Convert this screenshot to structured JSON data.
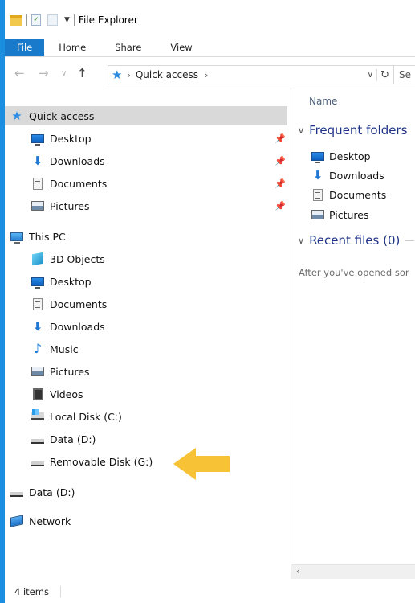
{
  "window": {
    "title": "File Explorer"
  },
  "ribbon": {
    "tabs": [
      "File",
      "Home",
      "Share",
      "View"
    ]
  },
  "address": {
    "path_root": "Quick access",
    "search_placeholder": "Se"
  },
  "nav": {
    "quick_access": "Quick access",
    "quick_items": [
      "Desktop",
      "Downloads",
      "Documents",
      "Pictures"
    ],
    "this_pc": "This PC",
    "pc_items": [
      "3D Objects",
      "Desktop",
      "Documents",
      "Downloads",
      "Music",
      "Pictures",
      "Videos",
      "Local Disk (C:)",
      "Data (D:)",
      "Removable Disk (G:)"
    ],
    "data_drive": "Data (D:)",
    "network": "Network"
  },
  "content": {
    "column_name": "Name",
    "frequent_header": "Frequent folders",
    "frequent_items": [
      "Desktop",
      "Downloads",
      "Documents",
      "Pictures"
    ],
    "recent_header": "Recent files (0)",
    "hint": "After you've opened sor"
  },
  "status": {
    "items": "4 items"
  },
  "colors": {
    "accent": "#1979ca",
    "background": "#1a8fe0",
    "annotation_arrow": "#f8c236"
  }
}
